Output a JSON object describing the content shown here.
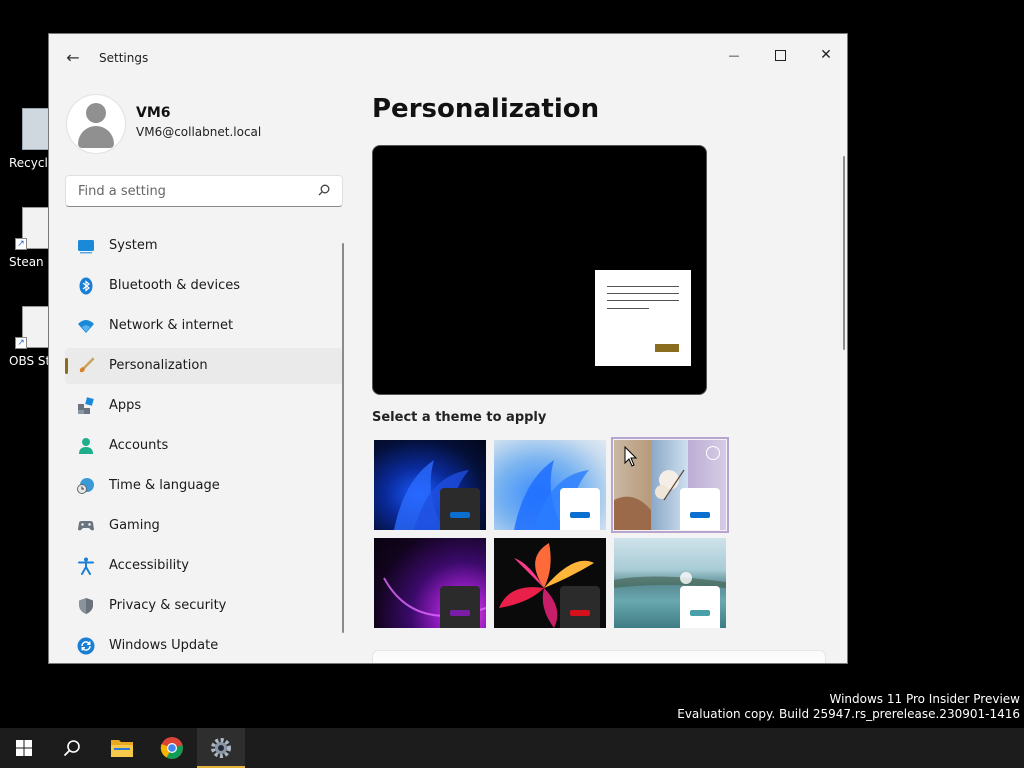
{
  "desktop": {
    "icons": [
      {
        "label": "Recycle"
      },
      {
        "label": "Stean"
      },
      {
        "label": "OBS Stu"
      }
    ]
  },
  "window": {
    "title": "Settings",
    "back_glyph": "←",
    "minimize_glyph": "—",
    "close_glyph": "✕"
  },
  "profile": {
    "name": "VM6",
    "email": "VM6@collabnet.local"
  },
  "search": {
    "placeholder": "Find a setting"
  },
  "nav": {
    "selected": "Personalization",
    "items": [
      {
        "label": "System",
        "icon": "system-icon"
      },
      {
        "label": "Bluetooth & devices",
        "icon": "bluetooth-icon"
      },
      {
        "label": "Network & internet",
        "icon": "network-icon"
      },
      {
        "label": "Personalization",
        "icon": "brush-icon"
      },
      {
        "label": "Apps",
        "icon": "apps-icon"
      },
      {
        "label": "Accounts",
        "icon": "accounts-icon"
      },
      {
        "label": "Time & language",
        "icon": "clock-globe-icon"
      },
      {
        "label": "Gaming",
        "icon": "controller-icon"
      },
      {
        "label": "Accessibility",
        "icon": "accessibility-icon"
      },
      {
        "label": "Privacy & security",
        "icon": "shield-icon"
      },
      {
        "label": "Windows Update",
        "icon": "update-icon"
      }
    ]
  },
  "main": {
    "title": "Personalization",
    "themes_label": "Select a theme to apply",
    "accent_color": "#8a6d1f",
    "themes": [
      {
        "name": "theme-windows-dark",
        "accent": "#0a6fd0"
      },
      {
        "name": "theme-windows-light",
        "accent": "#0a6fd0"
      },
      {
        "name": "theme-windows-spotlight",
        "accent": "#0a6fd0"
      },
      {
        "name": "theme-glow",
        "accent": "#7a1ea8"
      },
      {
        "name": "theme-captured-motion",
        "accent": "#d4101a"
      },
      {
        "name": "theme-flow",
        "accent": "#4aa0a8"
      }
    ]
  },
  "watermark": {
    "line1": "Windows 11 Pro Insider Preview",
    "line2": "Evaluation copy. Build 25947.rs_prerelease.230901-1416"
  },
  "taskbar": {
    "items": [
      "start-button",
      "search-button",
      "file-explorer",
      "chrome",
      "settings"
    ]
  }
}
